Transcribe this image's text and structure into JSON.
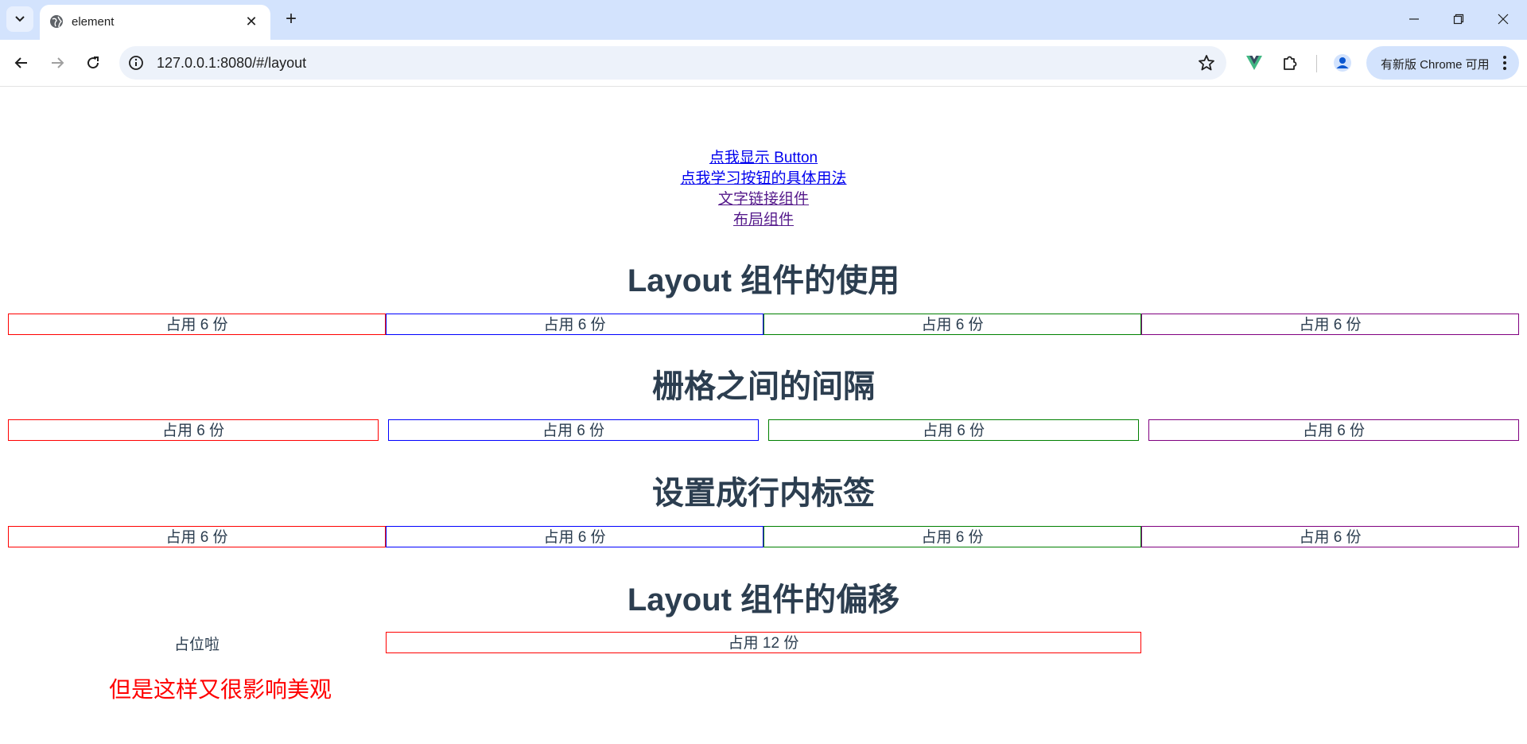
{
  "browser": {
    "tab_title": "element",
    "url": "127.0.0.1:8080/#/layout",
    "update_label": "有新版 Chrome 可用"
  },
  "nav_links": [
    {
      "label": "点我显示 Button",
      "state": "unvisited"
    },
    {
      "label": "点我学习按钮的具体用法",
      "state": "unvisited"
    },
    {
      "label": "文字链接组件",
      "state": "visited"
    },
    {
      "label": "布局组件",
      "state": "visited"
    }
  ],
  "sections": [
    {
      "title": "Layout 组件的使用",
      "cells": [
        "占用 6 份",
        "占用 6 份",
        "占用 6 份",
        "占用 6 份"
      ]
    },
    {
      "title": "栅格之间的间隔",
      "cells": [
        "占用 6 份",
        "占用 6 份",
        "占用 6 份",
        "占用 6 份"
      ]
    },
    {
      "title": "设置成行内标签",
      "cells": [
        "占用 6 份",
        "占用 6 份",
        "占用 6 份",
        "占用 6 份"
      ]
    },
    {
      "title": "Layout 组件的偏移",
      "placeholder": "占位啦",
      "cell": "占用 12 份"
    }
  ],
  "note": "但是这样又很影响美观",
  "colors": {
    "border_red": "#ff0000",
    "border_blue": "#0000ff",
    "border_green": "#008000",
    "border_purple": "#800080",
    "heading": "#2c3e50",
    "note": "#ff0000"
  }
}
